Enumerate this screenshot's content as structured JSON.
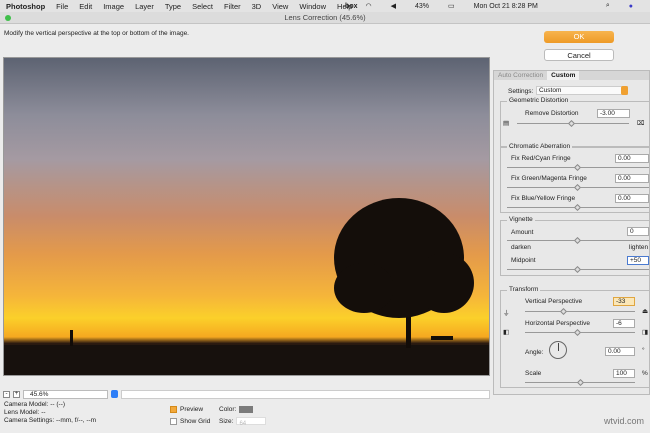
{
  "menubar": {
    "app": "Photoshop",
    "items": [
      "File",
      "Edit",
      "Image",
      "Layer",
      "Type",
      "Select",
      "Filter",
      "3D",
      "View",
      "Window",
      "Help"
    ],
    "box": "box",
    "battery": "43%",
    "clock": "Mon Oct 21  8:28 PM"
  },
  "window": {
    "title": "Lens Correction (45.6%)"
  },
  "hint": "Modify the vertical perspective at the top or bottom of the image.",
  "buttons": {
    "ok": "OK",
    "cancel": "Cancel"
  },
  "tabs": [
    "Auto Correction",
    "Custom"
  ],
  "settings": {
    "label": "Settings:",
    "value": "Custom"
  },
  "geometric": {
    "title": "Geometric Distortion",
    "remove_label": "Remove Distortion",
    "remove_value": "-3.00",
    "remove_pos": 0.47
  },
  "chromatic": {
    "title": "Chromatic Aberration",
    "items": [
      {
        "label": "Fix Red/Cyan Fringe",
        "value": "0.00"
      },
      {
        "label": "Fix Green/Magenta Fringe",
        "value": "0.00"
      },
      {
        "label": "Fix Blue/Yellow Fringe",
        "value": "0.00"
      }
    ]
  },
  "vignette": {
    "title": "Vignette",
    "amount_label": "Amount",
    "amount_value": "0",
    "darken": "darken",
    "lighten": "lighten",
    "midpoint_label": "Midpoint",
    "midpoint_value": "+50"
  },
  "transform": {
    "title": "Transform",
    "vertical_label": "Vertical Perspective",
    "vertical_value": "-33",
    "horizontal_label": "Horizontal Perspective",
    "horizontal_value": "-6",
    "angle_label": "Angle:",
    "angle_value": "0.00",
    "angle_unit": "°",
    "scale_label": "Scale",
    "scale_value": "100",
    "scale_unit": "%"
  },
  "zoom": {
    "value": "45.6%",
    "minus": "-",
    "plus": "+"
  },
  "info": {
    "camera_model": "Camera Model: -- (--)",
    "lens_model": "Lens Model: --",
    "camera_settings": "Camera Settings: --mm, f/--, --m"
  },
  "options": {
    "preview": "Preview",
    "show_grid": "Show Grid",
    "color": "Color:",
    "size": "Size:",
    "size_value": "64"
  },
  "watermark": "wtvid.com"
}
